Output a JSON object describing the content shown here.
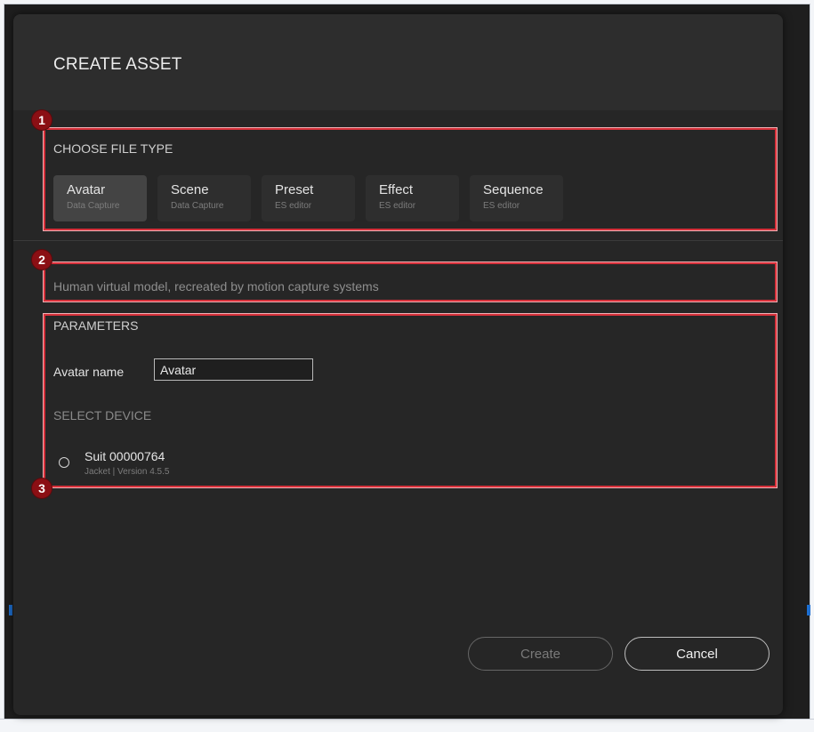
{
  "dialog": {
    "title": "CREATE ASSET"
  },
  "file_type": {
    "label": "CHOOSE FILE TYPE",
    "selected": "Avatar",
    "items": [
      {
        "name": "Avatar",
        "sub": "Data Capture"
      },
      {
        "name": "Scene",
        "sub": "Data Capture"
      },
      {
        "name": "Preset",
        "sub": "ES editor"
      },
      {
        "name": "Effect",
        "sub": "ES editor"
      },
      {
        "name": "Sequence",
        "sub": "ES editor"
      }
    ]
  },
  "description": "Human virtual model, recreated by motion capture systems",
  "parameters": {
    "label": "PARAMETERS",
    "avatar_name_label": "Avatar name",
    "avatar_name_value": "Avatar",
    "select_device_label": "SELECT DEVICE",
    "device": {
      "name": "Suit 00000764",
      "meta": "Jacket | Version 4.5.5",
      "selected": false
    }
  },
  "markers": [
    "1",
    "2",
    "3"
  ],
  "buttons": {
    "create": "Create",
    "cancel": "Cancel"
  },
  "colors": {
    "dialog_bg": "#262626",
    "highlight": "#d6303a",
    "marker": "#8b0f14"
  }
}
